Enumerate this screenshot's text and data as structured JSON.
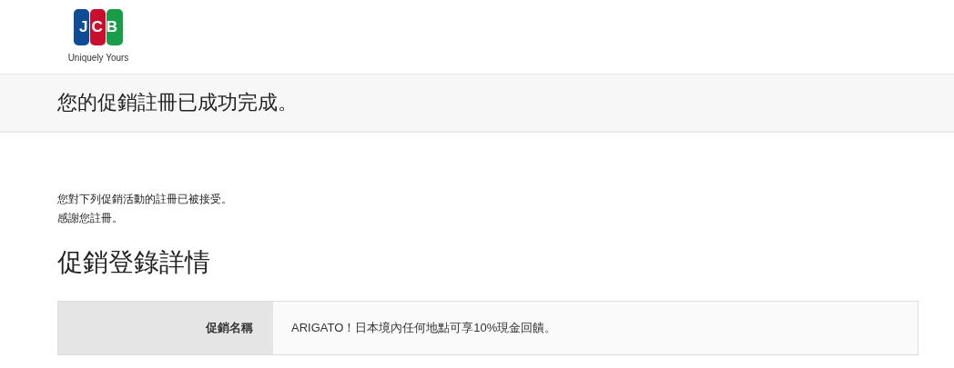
{
  "header": {
    "logo": {
      "letters": "JCB",
      "tagline": "Uniquely Yours"
    }
  },
  "title_band": {
    "title": "您的促銷註冊已成功完成。"
  },
  "message": [
    "您對下列促銷活動的註冊已被接受。",
    "感謝您註冊。"
  ],
  "section_heading": "促銷登錄詳情",
  "details": [
    {
      "label": "促銷名稱",
      "value": "ARIGATO！日本境內任何地點可享10%現金回饋。"
    }
  ]
}
